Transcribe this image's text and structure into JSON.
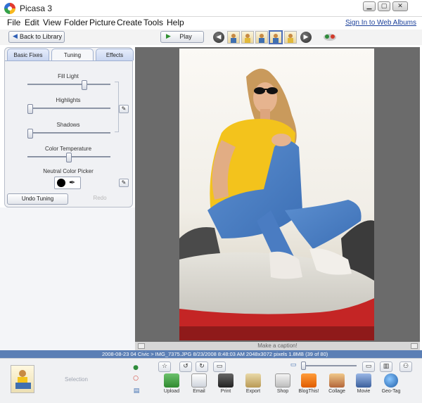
{
  "window": {
    "title": "Picasa 3",
    "min_icon": "minimize-icon",
    "max_icon": "maximize-icon",
    "close_icon": "close-icon"
  },
  "menu": {
    "items": [
      "File",
      "Edit",
      "View",
      "Folder",
      "Picture",
      "Create",
      "Tools",
      "Help"
    ],
    "sign_in": "Sign In to Web Albums"
  },
  "toolbar": {
    "back_label": "Back to Library",
    "play_label": "Play",
    "thumb_count": 5,
    "selected_thumb": 4
  },
  "tabs": {
    "basic": "Basic Fixes",
    "tuning": "Tuning",
    "effects": "Effects",
    "active": "Tuning"
  },
  "tuning": {
    "fill_light": {
      "label": "Fill Light",
      "value": 0.7
    },
    "highlights": {
      "label": "Highlights",
      "value": 0.0
    },
    "shadows": {
      "label": "Shadows",
      "value": 0.0
    },
    "color_temperature": {
      "label": "Color Temperature",
      "value": 0.5
    },
    "neutral_picker_label": "Neutral Color Picker",
    "neutral_color": "#000000",
    "undo_label": "Undo Tuning",
    "redo_label": "Redo"
  },
  "viewer": {
    "caption_placeholder": "Make a caption!"
  },
  "status": {
    "text": "2008-08-23 04 Civic > IMG_7375.JPG    8/23/2008 8:48:03 AM    2048x3072 pixels    1.8MB    (39 of 80)"
  },
  "tray": {
    "selection_label": "Selection"
  },
  "actions": [
    "Upload",
    "Email",
    "Print",
    "Export",
    "Shop",
    "BlogThis!",
    "Collage",
    "Movie",
    "Geo-Tag"
  ],
  "colors": {
    "status_bar": "#5b7fb5",
    "viewer_bg": "#6b6b6b",
    "tab_active_border": "#9fb0d0"
  }
}
